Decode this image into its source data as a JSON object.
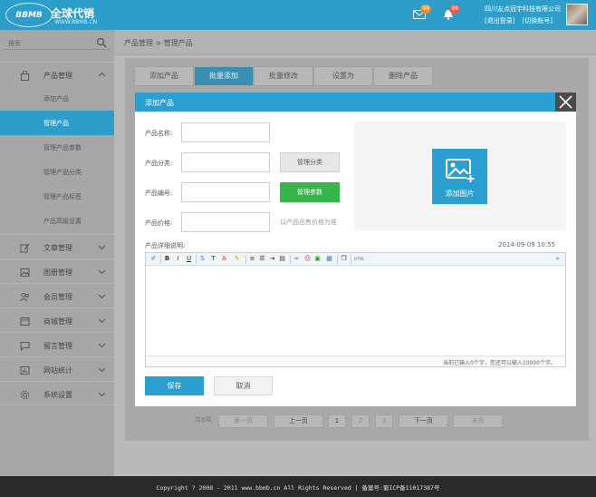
{
  "header": {
    "logo_badge": "BBMB",
    "logo_title": "全球代销",
    "logo_url": "WWW.BBMB.CN",
    "mail_count": "99",
    "bell_count": "99",
    "company": "四川友点冠宇科技有限公司",
    "logout": "[退出登录]",
    "switch_account": "[切换账号]"
  },
  "sidebar": {
    "search_placeholder": "搜索",
    "groups": [
      {
        "label": "产品管理",
        "icon": "bag-icon",
        "expanded": true
      },
      {
        "label": "文章管理",
        "icon": "edit-icon"
      },
      {
        "label": "图册管理",
        "icon": "album-icon"
      },
      {
        "label": "会员管理",
        "icon": "users-icon"
      },
      {
        "label": "商城管理",
        "icon": "shop-icon"
      },
      {
        "label": "留言管理",
        "icon": "message-icon"
      },
      {
        "label": "网站统计",
        "icon": "stats-icon"
      },
      {
        "label": "系统设置",
        "icon": "gear-icon"
      }
    ],
    "sub_items": [
      "添加产品",
      "管理产品",
      "管理产品参数",
      "管理产品分类",
      "管理产品标签",
      "产品高级设置"
    ],
    "active_sub": "管理产品"
  },
  "breadcrumb": "产品管理  >  管理产品",
  "tabs": [
    "添加产品",
    "批量添加",
    "批量修改",
    "设置为",
    "删除产品"
  ],
  "active_tab": "批量添加",
  "pagination": {
    "label": "共8项",
    "first": "第一页",
    "prev": "上一页",
    "pages": [
      "1",
      "2",
      "3"
    ],
    "next": "下一页",
    "last": "末页"
  },
  "footer": "Copyright ? 2008 - 2011 www.bbmb.cn All Rights Reserved | 备案号:蜀ICP备11017387号",
  "modal": {
    "title": "添加产品",
    "fields": {
      "name_label": "产品名称:",
      "category_label": "产品分类:",
      "code_label": "产品编号:",
      "price_label": "产品价格:"
    },
    "manage_category_btn": "管理分类",
    "manage_params_btn": "管理参数",
    "price_hint": "以产品出售价格为准",
    "add_image_label": "添加图片",
    "detail_label": "产品详细说明:",
    "datetime": "2014-09-09  10:55",
    "editor_status": "当前已输入0个字，您还可以输入10000个字。",
    "save_btn": "保存",
    "cancel_btn": "取消"
  },
  "colors": {
    "brand": "#2c9ec9",
    "modal_header": "#2a9fd0",
    "green": "#37b44a",
    "footer": "#2a2a2a"
  }
}
